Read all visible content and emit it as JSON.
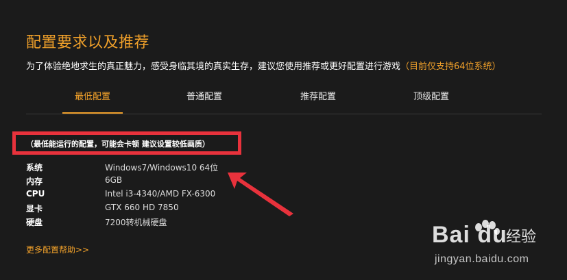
{
  "header": {
    "title": "配置要求以及推荐",
    "subtitle": "为了体验绝地求生的真正魅力，感受身临其境的真实生存，建议您使用推荐或更好配置进行游戏",
    "subtitle_note": "（目前仅支持64位系统）"
  },
  "tabs": [
    {
      "label": "最低配置",
      "active": true
    },
    {
      "label": "普通配置",
      "active": false
    },
    {
      "label": "推荐配置",
      "active": false
    },
    {
      "label": "顶级配置",
      "active": false
    }
  ],
  "min_note": "（最低能运行的配置，可能会卡顿 建议设置较低画质）",
  "specs": [
    {
      "label": "系统",
      "value": "Windows7/Windows10 64位"
    },
    {
      "label": "内存",
      "value": "6GB"
    },
    {
      "label": "CPU",
      "value": "Intel i3-4340/AMD FX-6300"
    },
    {
      "label": "显卡",
      "value": "GTX 660 HD 7850"
    },
    {
      "label": "硬盘",
      "value": "7200转机械硬盘"
    }
  ],
  "more_link": "更多配置帮助>>",
  "watermark": {
    "brand": "Bai du",
    "cn": "经验",
    "url": "jingyan.baidu.com"
  },
  "colors": {
    "accent": "#f0a02a",
    "highlight": "#e8323c",
    "background": "#1b1b1b"
  }
}
